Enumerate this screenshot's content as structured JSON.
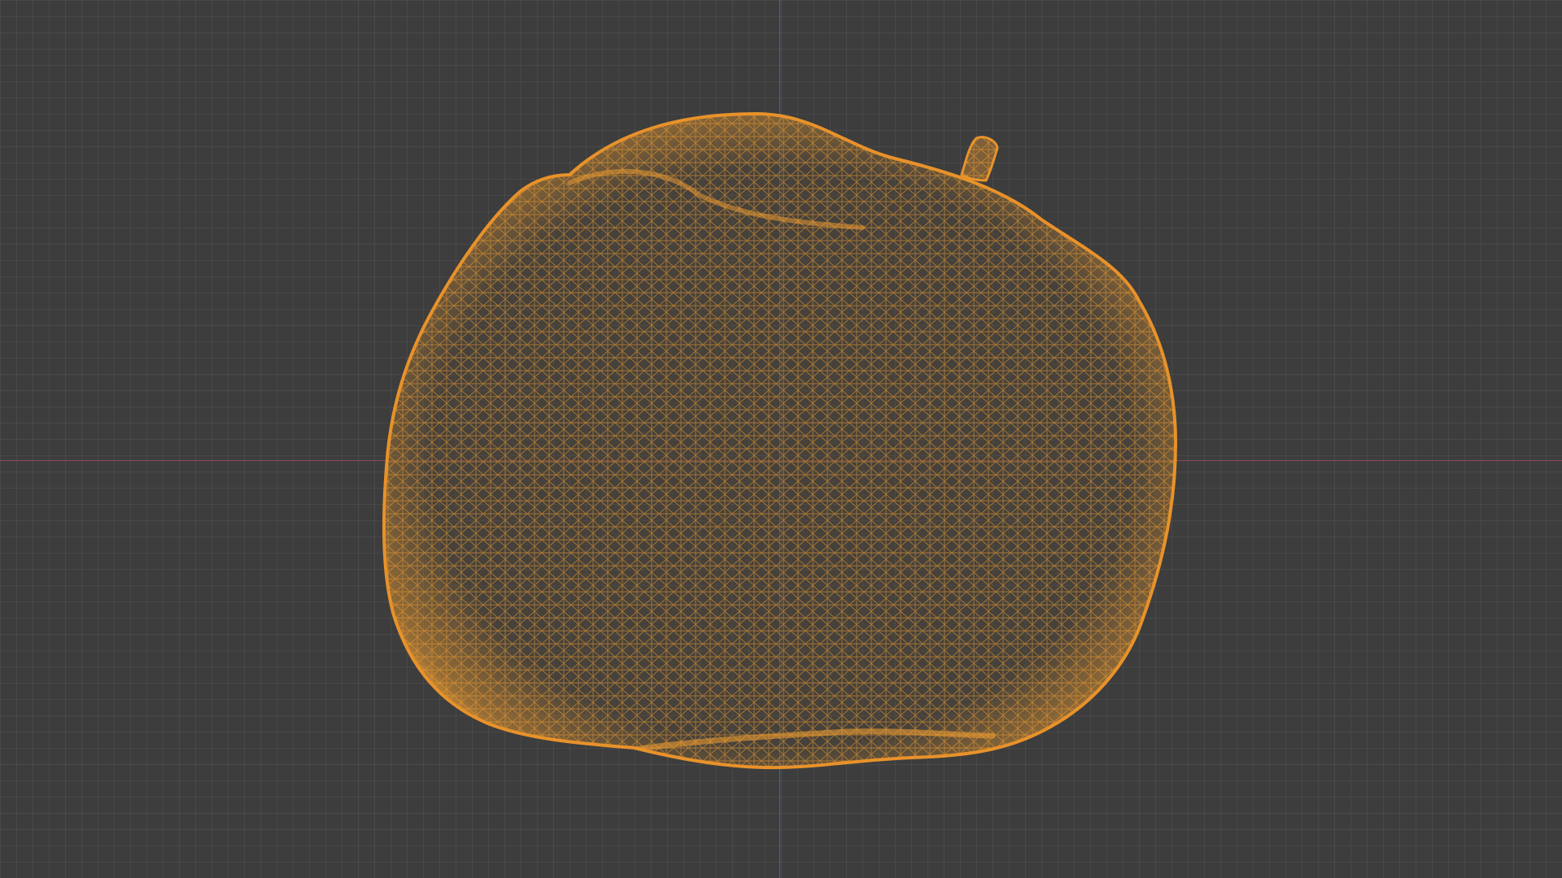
{
  "viewport": {
    "background_color": "#3d3d3d",
    "grid_color": "#4a4a4a",
    "x_axis_color": "#8a4a55",
    "y_axis_color": "#4a6a96"
  },
  "object": {
    "display_mode": "wireframe",
    "selected": true,
    "wire_color": "#f5a030",
    "outline_color": "#e8922a",
    "shape": "fruit-mesh"
  }
}
